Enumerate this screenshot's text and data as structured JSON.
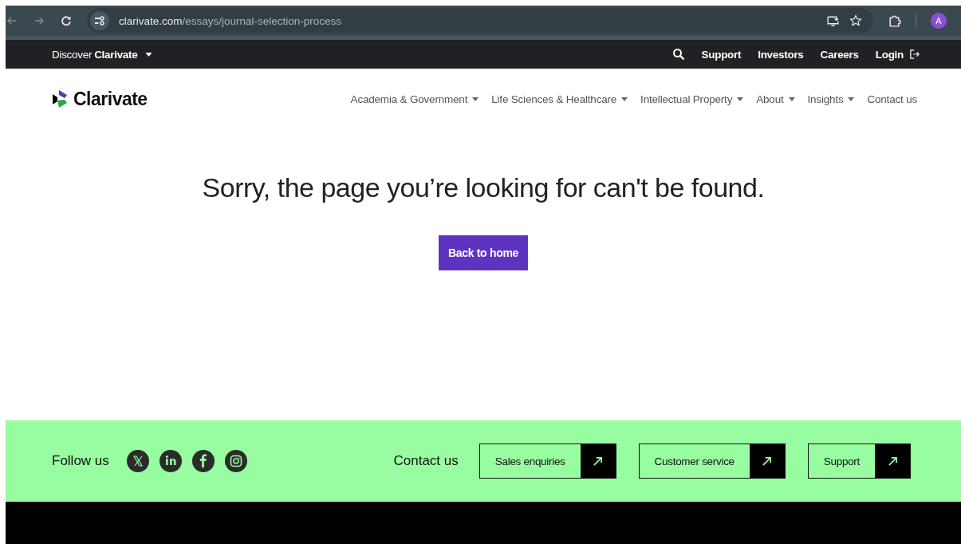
{
  "browser": {
    "url_host": "clarivate.com",
    "url_path": "/essays/journal-selection-process",
    "avatar": "A"
  },
  "utility_bar": {
    "discover_prefix": "Discover",
    "discover_brand": "Clarivate",
    "links": [
      "Support",
      "Investors",
      "Careers"
    ],
    "login": "Login"
  },
  "header": {
    "logo": "Clarivate",
    "nav": [
      {
        "label": "Academia & Government",
        "kind": "dropdown"
      },
      {
        "label": "Life Sciences & Healthcare",
        "kind": "dropdown"
      },
      {
        "label": "Intellectual Property",
        "kind": "dropdown"
      },
      {
        "label": "About",
        "kind": "dropdown"
      },
      {
        "label": "Insights",
        "kind": "dropdown"
      },
      {
        "label": "Contact us",
        "kind": "link"
      }
    ]
  },
  "main": {
    "heading": "Sorry, the page you’re looking for can't be found.",
    "button": "Back to home"
  },
  "footer": {
    "follow_label": "Follow us",
    "social": [
      {
        "kind": "x"
      },
      {
        "kind": "linkedin"
      },
      {
        "kind": "facebook"
      },
      {
        "kind": "instagram"
      }
    ],
    "contact_label": "Contact us",
    "contact_buttons": [
      "Sales enquiries",
      "Customer service",
      "Support"
    ]
  }
}
